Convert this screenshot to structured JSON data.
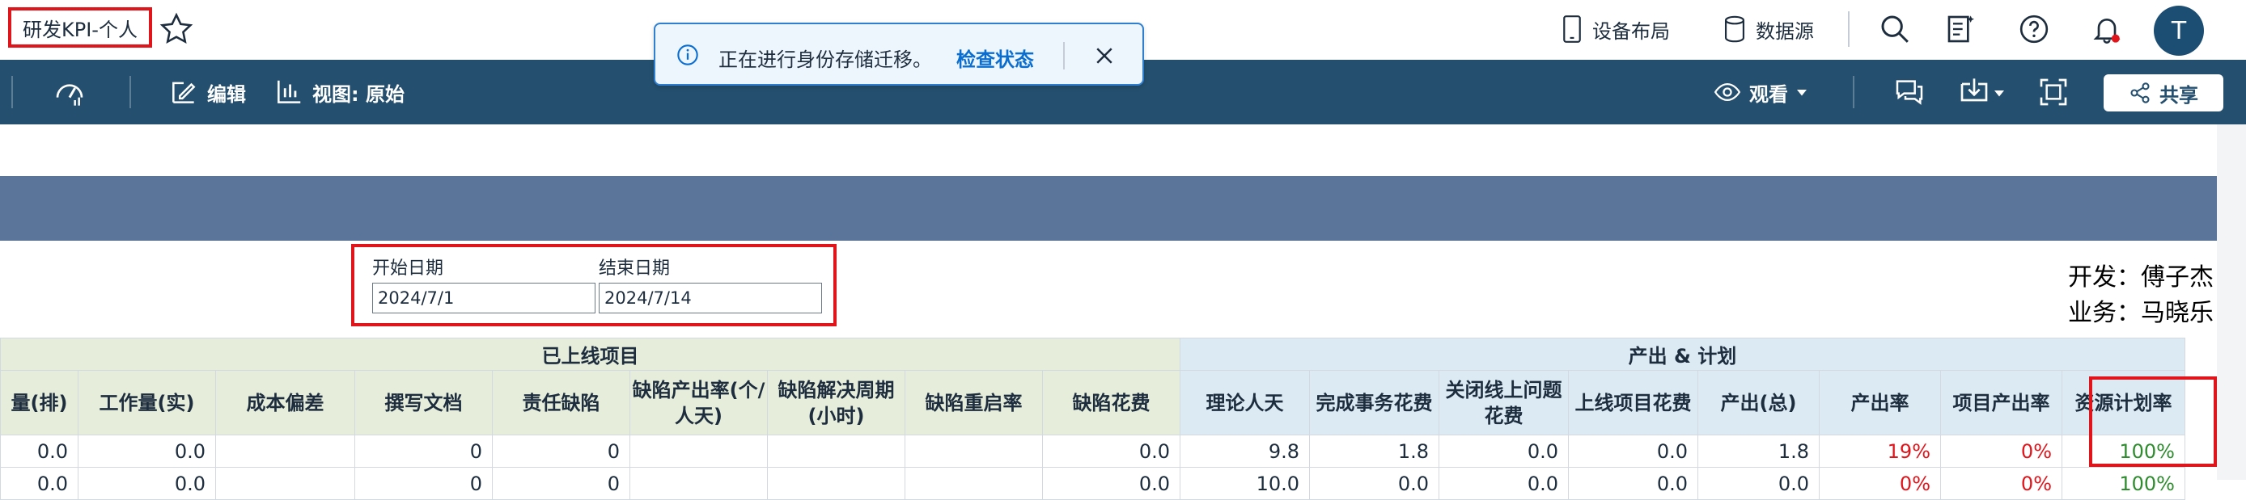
{
  "header": {
    "title": "研发KPI-个人",
    "notification": {
      "message": "正在进行身份存储迁移。",
      "link": "检查状态"
    },
    "device_layout": "设备布局",
    "data_source": "数据源",
    "avatar_initial": "T"
  },
  "toolbar": {
    "edit": "编辑",
    "view": "视图: 原始",
    "watch": "观看",
    "share": "共享"
  },
  "filters": {
    "start_label": "开始日期",
    "start_value": "2024/7/1",
    "end_label": "结束日期",
    "end_value": "2024/7/14"
  },
  "people": {
    "dev": "开发：傅子杰",
    "biz": "业务：马晓乐"
  },
  "table": {
    "group_online": "已上线项目",
    "group_output": "产出 & 计划",
    "columns": [
      "量(排)",
      "工作量(实)",
      "成本偏差",
      "撰写文档",
      "责任缺陷",
      "缺陷产出率(个/人天)",
      "缺陷解决周期(小时)",
      "缺陷重启率",
      "缺陷花费",
      "理论人天",
      "完成事务花费",
      "关闭线上问题花费",
      "上线项目花费",
      "产出(总)",
      "产出率",
      "项目产出率",
      "资源计划率"
    ],
    "row1": [
      "0.0",
      "0.0",
      "",
      "0",
      "0",
      "",
      "",
      "",
      "0.0",
      "9.8",
      "1.8",
      "0.0",
      "0.0",
      "1.8",
      "19%",
      "0%",
      "100%"
    ],
    "row2": [
      "0.0",
      "0.0",
      "",
      "0",
      "0",
      "",
      "",
      "",
      "0.0",
      "10.0",
      "0.0",
      "0.0",
      "0.0",
      "0.0",
      "0%",
      "0%",
      "100%"
    ]
  },
  "colors": {
    "toolbar_bg": "#244f6e",
    "banner_bg": "#5b7499",
    "highlight": "#e0151c",
    "negative": "#e0151c",
    "positive": "#2e8b2e"
  }
}
